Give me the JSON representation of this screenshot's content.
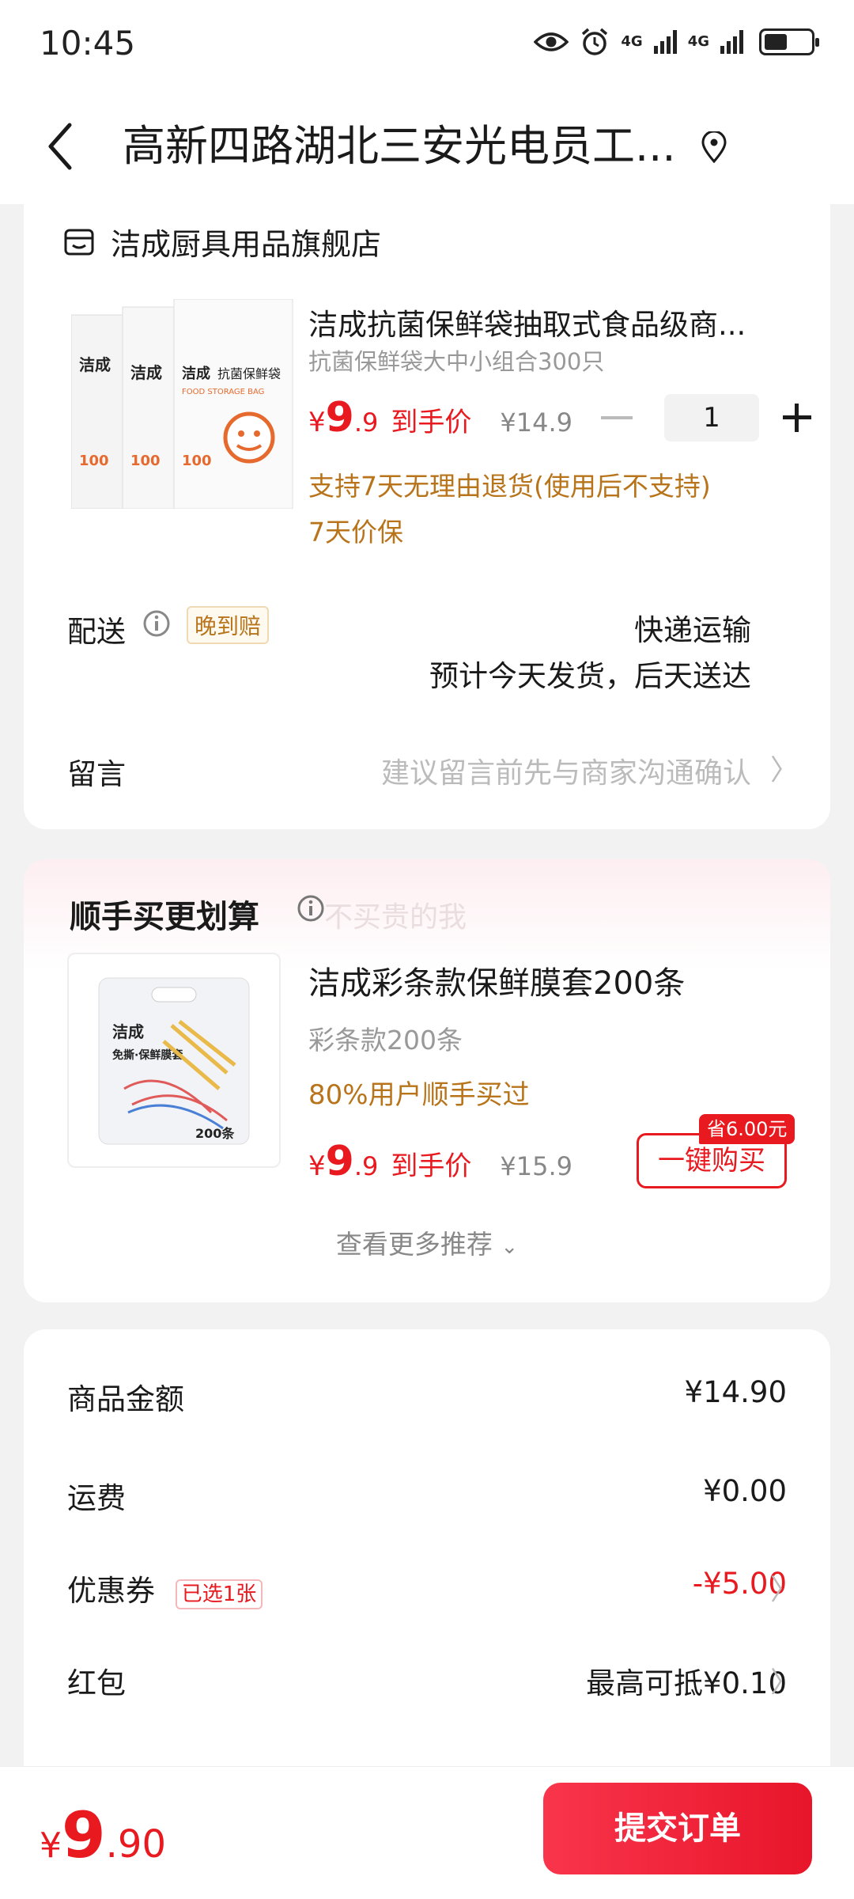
{
  "status_bar": {
    "time": "10:45",
    "net1": "4G",
    "net2": "4G"
  },
  "header": {
    "title": "高新四路湖北三安光电员工..."
  },
  "store": {
    "name": "洁成厨具用品旗舰店"
  },
  "product": {
    "title": "洁成抗菌保鲜袋抽取式食品级商...",
    "spec": "抗菌保鲜袋大中小组合300只",
    "currency": "¥",
    "price_int": "9",
    "price_dec": ".9",
    "final_label": "到手价",
    "original_price": "¥14.9",
    "quantity": "1",
    "return_policy": "支持7天无理由退货(使用后不支持)",
    "price_protect": "7天价保",
    "image_texts": {
      "brand": "洁成",
      "name": "抗菌保鲜袋",
      "eng": "FOOD STORAGE BAG",
      "count": "100"
    }
  },
  "delivery": {
    "label": "配送",
    "late_tag": "晚到赔",
    "method": "快递运输",
    "eta": "预计今天发货，后天送达"
  },
  "message": {
    "label": "留言",
    "placeholder": "建议留言前先与商家沟通确认"
  },
  "bundle": {
    "title": "顺手买更划算",
    "subtitle": "不买贵的我",
    "item": {
      "title": "洁成彩条款保鲜膜套200条",
      "spec": "彩条款200条",
      "bought": "80%用户顺手买过",
      "currency": "¥",
      "price_int": "9",
      "price_dec": ".9",
      "final_label": "到手价",
      "original_price": "¥15.9",
      "save_tag": "省6.00元",
      "buy_label": "一键购买",
      "image_texts": {
        "brand": "洁成",
        "name": "免撕·保鲜膜套",
        "count": "200条"
      }
    },
    "more": "查看更多推荐"
  },
  "summary": {
    "goods_label": "商品金额",
    "goods_value": "¥14.90",
    "shipping_label": "运费",
    "shipping_value": "¥0.00",
    "coupon_label": "优惠券",
    "coupon_tag": "已选1张",
    "coupon_value": "-¥5.00",
    "redpacket_label": "红包",
    "redpacket_value": "最高可抵¥0.10"
  },
  "bottom": {
    "currency": "¥",
    "total_int": "9",
    "total_dec": ".90",
    "submit": "提交订单"
  },
  "colors": {
    "accent_red": "#e8191f",
    "note_orange": "#b8741a"
  }
}
